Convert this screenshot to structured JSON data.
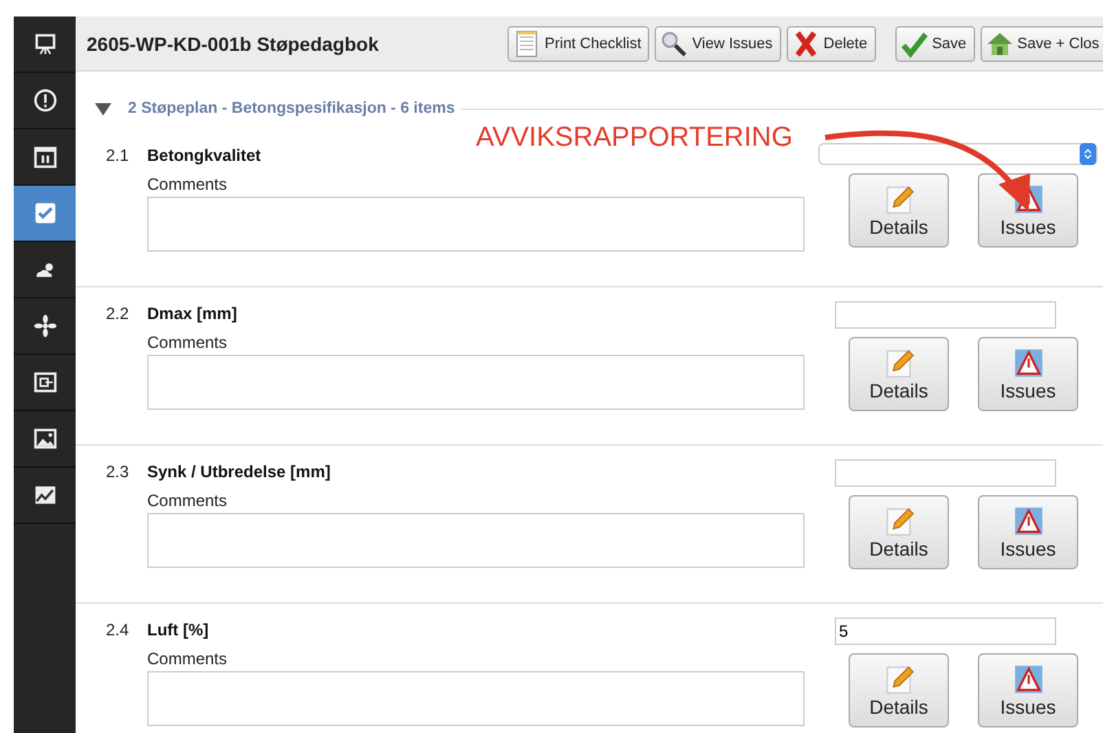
{
  "sidebar": {
    "items": [
      {
        "kind": "easel",
        "selected": false
      },
      {
        "kind": "alert",
        "selected": false
      },
      {
        "kind": "calendar",
        "selected": false
      },
      {
        "kind": "check",
        "selected": true
      },
      {
        "kind": "weather",
        "selected": false
      },
      {
        "kind": "fan",
        "selected": false
      },
      {
        "kind": "export",
        "selected": false
      },
      {
        "kind": "image",
        "selected": false
      },
      {
        "kind": "chart",
        "selected": false
      }
    ]
  },
  "header": {
    "title": "2605-WP-KD-001b Støpedagbok",
    "buttons": [
      {
        "kind": "print",
        "label": "Print Checklist"
      },
      {
        "kind": "search",
        "label": "View Issues"
      },
      {
        "kind": "delete",
        "label": "Delete"
      },
      {
        "kind": "save",
        "label": "Save"
      },
      {
        "kind": "home",
        "label": "Save + Clos"
      }
    ]
  },
  "section": {
    "title": "2 Støpeplan - Betongspesifikasjon - 6 items",
    "expanded": true
  },
  "annotation": {
    "text": "AVVIKSRAPPORTERING"
  },
  "items": [
    {
      "number": "2.1",
      "label": "Betongkvalitet",
      "kind": "select",
      "comments_label": "Comments",
      "details": "Details",
      "issues": "Issues"
    },
    {
      "number": "2.2",
      "label": "Dmax [mm]",
      "kind": "text",
      "comments_label": "Comments",
      "details": "Details",
      "issues": "Issues"
    },
    {
      "number": "2.3",
      "label": "Synk / Utbredelse [mm]",
      "kind": "text",
      "comments_label": "Comments",
      "details": "Details",
      "issues": "Issues"
    },
    {
      "number": "2.4",
      "label": "Luft [%]",
      "kind": "text",
      "value": "5",
      "comments_label": "Comments",
      "details": "Details",
      "issues": "Issues"
    }
  ]
}
